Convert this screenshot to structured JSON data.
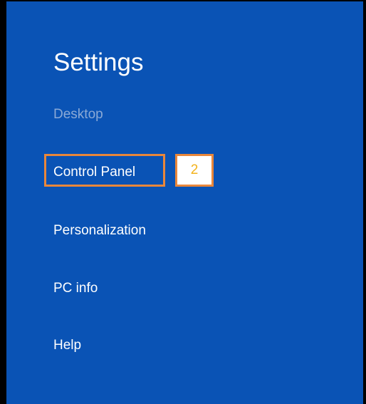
{
  "panel": {
    "title": "Settings",
    "accent_color": "#0a53b5",
    "items": [
      {
        "label": "Desktop",
        "state": "disabled"
      },
      {
        "label": "Control Panel",
        "state": "highlighted"
      },
      {
        "label": "Personalization",
        "state": "normal"
      },
      {
        "label": "PC info",
        "state": "normal"
      },
      {
        "label": "Help",
        "state": "normal"
      }
    ]
  },
  "annotation": {
    "step_number": "2",
    "highlight_color": "#e9873b",
    "number_color": "#f3b21b"
  }
}
